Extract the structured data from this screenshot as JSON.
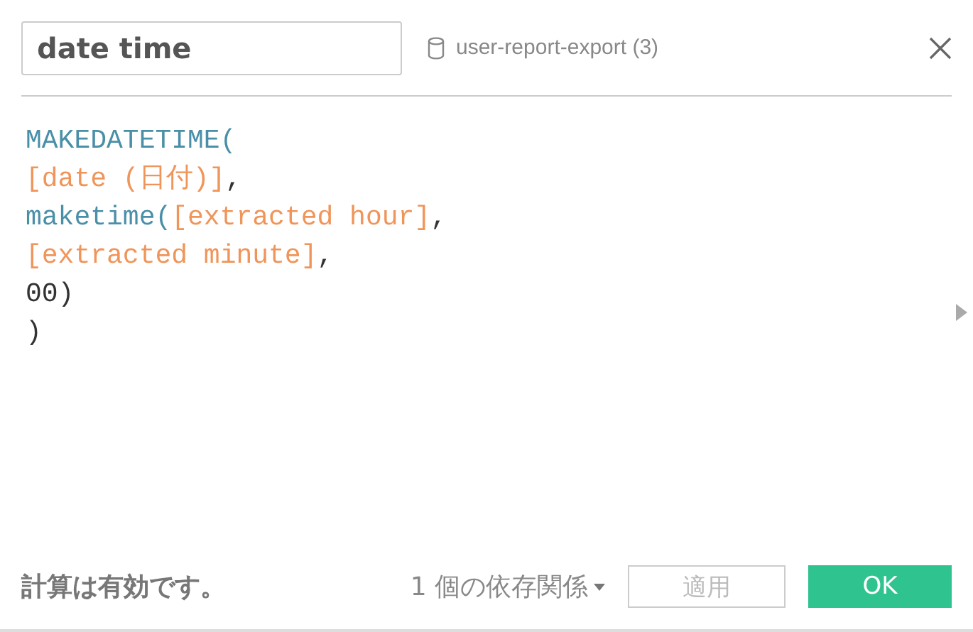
{
  "header": {
    "name_field": {
      "value": "date time"
    },
    "datasource": "user-report-export (3)"
  },
  "code_lines": [
    [
      {
        "kind": "function",
        "text": "MAKEDATETIME("
      }
    ],
    [
      {
        "kind": "field",
        "text": "[date (日付)]"
      },
      {
        "kind": "plain",
        "text": ","
      }
    ],
    [
      {
        "kind": "function",
        "text": "maketime("
      },
      {
        "kind": "field",
        "text": "[extracted hour]"
      },
      {
        "kind": "plain",
        "text": ","
      }
    ],
    [
      {
        "kind": "field",
        "text": "[extracted minute]"
      },
      {
        "kind": "plain",
        "text": ","
      }
    ],
    [
      {
        "kind": "plain",
        "text": "00)"
      }
    ],
    [
      {
        "kind": "plain",
        "text": ")"
      }
    ]
  ],
  "footer": {
    "status": "計算は有効です。",
    "dependencies": "1 個の依存関係",
    "buttons": [
      {
        "label": "適用",
        "kind": "secondary",
        "disabled": true
      },
      {
        "label": "OK",
        "kind": "primary",
        "disabled": false
      }
    ]
  }
}
